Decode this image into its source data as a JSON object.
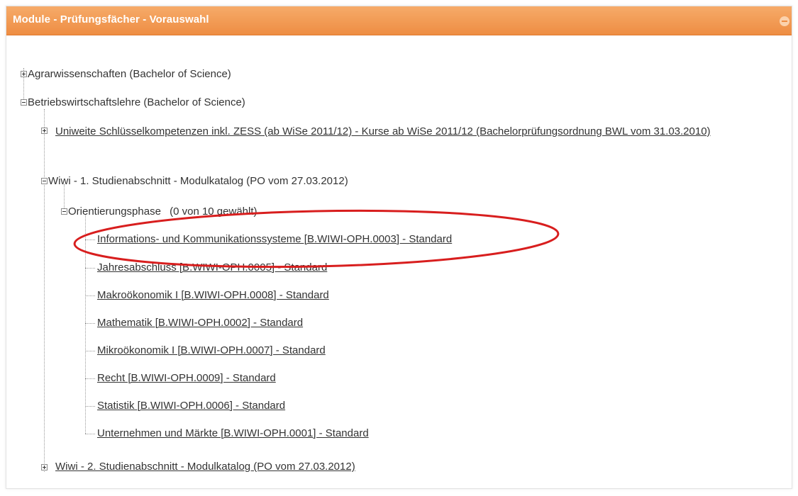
{
  "panel": {
    "title": "Module - Prüfungsfächer - Vorauswahl",
    "collapse_icon": "minus-circle-icon",
    "accent_color": "#ee8d43",
    "highlight_color": "#d81e1e"
  },
  "tree": {
    "n1": "Agrarwissenschaften (Bachelor of Science)",
    "n2": "Betriebswirtschaftslehre (Bachelor of Science)",
    "n2a": "Uniweite Schlüsselkompetenzen inkl. ZESS (ab WiSe 2011/12) - Kurse ab WiSe 2011/12 (Bachelorprüfungsordnung BWL vom 31.03.2010)",
    "n2b": "Wiwi - 1. Studienabschnitt - Modulkatalog (PO vom 27.03.2012)",
    "n2b1": "Orientierungsphase",
    "n2b1_count": "(0 von 10 gewählt)",
    "modules": [
      "Informations- und Kommunikationssysteme [B.WIWI-OPH.0003] - Standard",
      "Jahresabschluss [B.WIWI-OPH.0005] - Standard",
      "Makroökonomik I [B.WIWI-OPH.0008] - Standard",
      "Mathematik [B.WIWI-OPH.0002] - Standard",
      "Mikroökonomik I [B.WIWI-OPH.0007] - Standard",
      "Recht [B.WIWI-OPH.0009] - Standard",
      "Statistik [B.WIWI-OPH.0006] - Standard",
      "Unternehmen und Märkte [B.WIWI-OPH.0001] - Standard"
    ],
    "n2c": "Wiwi - 2. Studienabschnitt - Modulkatalog (PO vom 27.03.2012)"
  }
}
